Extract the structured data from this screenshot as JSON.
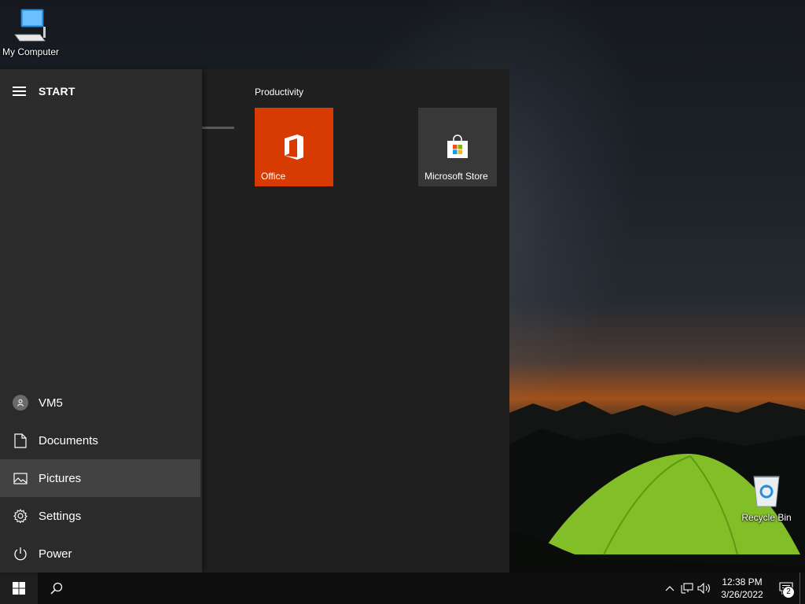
{
  "desktop": {
    "icons": [
      {
        "label": "My Computer",
        "icon": "computer-icon"
      },
      {
        "label": "Recycle Bin",
        "icon": "recycle-bin-icon"
      }
    ]
  },
  "start_menu": {
    "title": "START",
    "left_items": [
      {
        "label": "VM5",
        "icon": "user-avatar-icon"
      },
      {
        "label": "Documents",
        "icon": "document-icon"
      },
      {
        "label": "Pictures",
        "icon": "pictures-icon",
        "hovered": true
      },
      {
        "label": "Settings",
        "icon": "gear-icon"
      },
      {
        "label": "Power",
        "icon": "power-icon"
      }
    ],
    "group_label": "Productivity",
    "tiles": [
      {
        "label": "Office",
        "icon": "office-icon",
        "color": "#d83b01"
      },
      {
        "label": "Microsoft Store",
        "icon": "store-bag-icon",
        "color": "#383838"
      }
    ]
  },
  "taskbar": {
    "time": "12:38 PM",
    "date": "3/26/2022",
    "notification_count": "2",
    "tray_icons": [
      "chevron-up-icon",
      "network-icon",
      "volume-icon"
    ]
  },
  "colors": {
    "accent": "#d83b01",
    "menu_left": "#2b2b2b",
    "menu_right": "#1f1f1f",
    "taskbar": "#0f0f0f"
  }
}
